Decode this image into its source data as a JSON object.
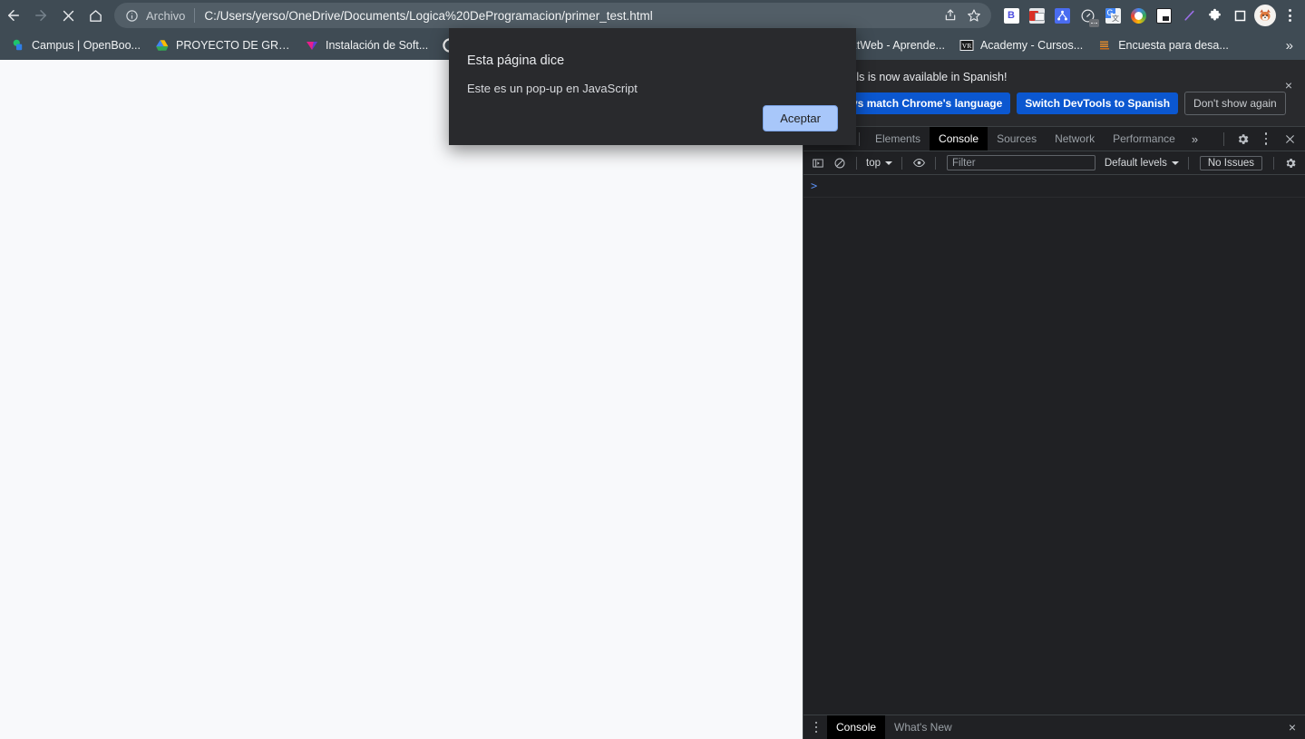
{
  "browser": {
    "nav": {
      "back_label": "Back",
      "forward_label": "Forward",
      "stop_label": "Stop",
      "home_label": "Home"
    },
    "omnibox": {
      "scheme_label": "Archivo",
      "url": "C:/Users/yerso/OneDrive/Documents/Logica%20DeProgramacion/primer_test.html",
      "share_label": "Share this page",
      "bookmark_label": "Bookmark this tab"
    },
    "extensions": [
      {
        "name": "bitwarden-extension-icon",
        "color": "#ffffff",
        "glyph": "B",
        "glyph_color": "#4e4ee0"
      },
      {
        "name": "chrome-remote-desktop-extension-icon",
        "color": "#d6d8db",
        "glyph": "",
        "glyph_color": "#d93025"
      },
      {
        "name": "sitemap-extension-icon",
        "color": "#4a6cf0",
        "glyph": "",
        "glyph_color": "#ffffff"
      },
      {
        "name": "speedtest-extension-icon",
        "color": "transparent",
        "glyph": "",
        "glyph_color": "#e8eaed"
      },
      {
        "name": "google-translate-extension-icon",
        "color": "#4285f4",
        "glyph": "G",
        "glyph_color": "#ffffff"
      },
      {
        "name": "color-wheel-extension-icon",
        "color": "#ffffff",
        "glyph": "",
        "glyph_color": "#34a853"
      },
      {
        "name": "picture-in-picture-icon",
        "color": "#ffffff",
        "glyph": "",
        "glyph_color": "#202124"
      },
      {
        "name": "highlighter-pen-extension-icon",
        "color": "transparent",
        "glyph": "",
        "glyph_color": "#9b6ee8"
      },
      {
        "name": "extensions-puzzle-icon",
        "color": "transparent",
        "glyph": "",
        "glyph_color": "#ffffff"
      },
      {
        "name": "reading-list-icon",
        "color": "transparent",
        "glyph": "",
        "glyph_color": "#ffffff"
      }
    ],
    "profile_label": "Profile",
    "menu_label": "Customize and control Google Chrome"
  },
  "bookmarks": {
    "items": [
      {
        "label": "Campus | OpenBoo...",
        "icon": "campus-favicon"
      },
      {
        "label": "PROYECTO DE GRA...",
        "icon": "google-drive-favicon"
      },
      {
        "label": "Instalación de Soft...",
        "icon": "instalacion-favicon"
      },
      {
        "label": "C...",
        "icon": "circle-favicon"
      },
      {
        "label": "aztWeb - Aprende...",
        "icon": "aztweb-favicon"
      },
      {
        "label": "Academy - Cursos...",
        "icon": "academy-favicon"
      },
      {
        "label": "Encuesta para desa...",
        "icon": "encuesta-favicon"
      }
    ],
    "overflow_label": "»"
  },
  "dialog": {
    "title": "Esta página dice",
    "message": "Este es un pop-up en JavaScript",
    "accept_label": "Aceptar"
  },
  "devtools": {
    "notice": {
      "text": "DevTools is now available in Spanish!",
      "primary_label": "Always match Chrome's language",
      "secondary_label": "Switch DevTools to Spanish",
      "dismiss_label": "Don't show again",
      "close_label": "×"
    },
    "tabs": [
      {
        "label": "Elements",
        "active": false
      },
      {
        "label": "Console",
        "active": true
      },
      {
        "label": "Sources",
        "active": false
      },
      {
        "label": "Network",
        "active": false
      },
      {
        "label": "Performance",
        "active": false
      }
    ],
    "more_tabs_label": "»",
    "settings_label": "Settings",
    "more_options_label": "More options",
    "close_label": "Close DevTools",
    "console_toolbar": {
      "sidebar_label": "Show console sidebar",
      "clear_label": "Clear console",
      "context": "top",
      "eye_label": "Create live expression",
      "filter_placeholder": "Filter",
      "levels_label": "Default levels",
      "issues_label": "No Issues",
      "settings_label": "Console settings"
    },
    "console_prompt_caret": ">",
    "drawer": {
      "tabs": [
        {
          "label": "Console",
          "active": true
        },
        {
          "label": "What's New",
          "active": false
        }
      ],
      "close_label": "×"
    }
  },
  "colors": {
    "chrome_frame": "#3f4b54",
    "omnibox_bg": "#525e67",
    "page_bg": "#f8f9fb",
    "devtools_bg": "#202124",
    "devtools_panel": "#292a2d",
    "accent_blue": "#0b57d0",
    "dialog_button": "#a8c7fa"
  }
}
